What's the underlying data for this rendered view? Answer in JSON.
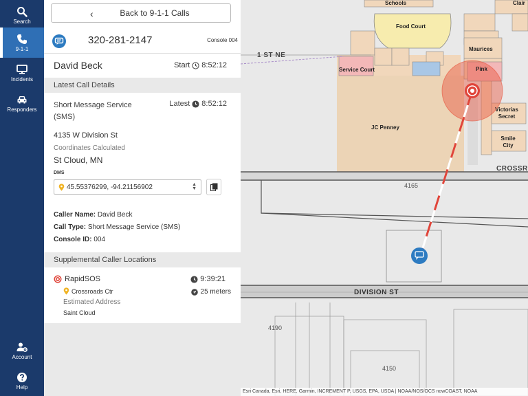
{
  "nav": {
    "items": [
      {
        "label": "Search",
        "icon": "search-icon"
      },
      {
        "label": "9-1-1",
        "icon": "phone-icon",
        "active": true
      },
      {
        "label": "Incidents",
        "icon": "monitor-icon"
      },
      {
        "label": "Responders",
        "icon": "car-icon"
      }
    ],
    "bottom_items": [
      {
        "label": "Account",
        "icon": "user-gear-icon"
      },
      {
        "label": "Help",
        "icon": "help-icon"
      }
    ]
  },
  "panel": {
    "back_label": "Back to 9-1-1 Calls",
    "phone_number": "320-281-2147",
    "console": "Console 004",
    "caller_name": "David Beck",
    "start_label": "Start",
    "start_time": "8:52:12",
    "latest_details_header": "Latest Call Details",
    "service": "Short Message Service (SMS)",
    "latest_label": "Latest",
    "latest_time": "8:52:12",
    "address_line": "4135 W Division St",
    "coords_status": "Coordinates Calculated",
    "city_state": "St Cloud, MN",
    "dms_label": "DMS",
    "dms_value": "45.55376299, -94.21156902",
    "caller_name_label": "Caller Name:",
    "caller_name_value": "David Beck",
    "call_type_label": "Call Type:",
    "call_type_value": "Short Message Service (SMS)",
    "console_id_label": "Console ID:",
    "console_id_value": "004",
    "supplemental_header": "Supplemental Caller Locations",
    "supplemental": {
      "provider": "RapidSOS",
      "time": "9:39:21",
      "place": "Crossroads Ctr",
      "accuracy": "25 meters",
      "address_type": "Estimated Address",
      "city": "Saint Cloud"
    }
  },
  "map": {
    "labels": {
      "schools": "Schools",
      "clair": "Clair",
      "food_court": "Food Court",
      "maurices": "Maurices",
      "pink": "Pink",
      "service_court": "Service Court",
      "jc_penney": "JC Penney",
      "victorias_secret": "Victorias Secret",
      "smile_city": "Smile City"
    },
    "streets": {
      "first_st": "1 ST NE",
      "crossroads": "CROSSR",
      "division": "DIVISION ST"
    },
    "numbers": [
      "4165",
      "4190",
      "4150"
    ],
    "attribution": "Esri Canada, Esri, HERE, Garmin, INCREMENT P, USGS, EPA, USDA | NOAA/NOS/OCS nowCOAST, NOAA"
  },
  "colors": {
    "nav_bg": "#1b3a6b",
    "nav_active": "#2f6fb5",
    "accent_blue": "#2d7bc1",
    "rapidsos_red": "#e0453a",
    "pin_yellow": "#f0b323"
  }
}
